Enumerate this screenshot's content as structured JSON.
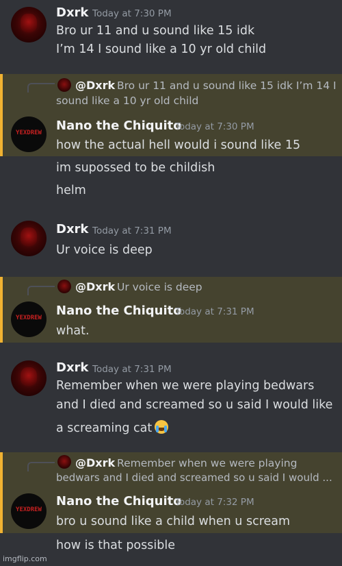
{
  "messages": [
    {
      "author": "Dxrk",
      "time": "Today at 7:30 PM",
      "lines": [
        "Bro ur 11 and u sound like 15 idk",
        "I’m 14 I sound like a 10 yr old child"
      ]
    },
    {
      "reply_to": {
        "author": "@Dxrk",
        "text_line1": "Bro ur 11 and u sound like 15 idk  I’m 14 I",
        "text_line2": "sound like a 10 yr old child"
      },
      "author": "Nano the Chiquito",
      "time": "Today at 7:30 PM",
      "lines": [
        "how the actual hell would i sound like 15",
        "im supossed to be childish",
        "helm"
      ]
    },
    {
      "author": "Dxrk",
      "time": "Today at 7:31 PM",
      "lines": [
        "Ur voice is deep"
      ]
    },
    {
      "reply_to": {
        "author": "@Dxrk",
        "text_line1": "Ur voice is deep"
      },
      "author": "Nano the Chiquito",
      "time": "Today at 7:31 PM",
      "lines": [
        "what."
      ]
    },
    {
      "author": "Dxrk",
      "time": "Today at 7:31 PM",
      "lines": [
        "Remember when we were playing bedwars",
        "and I died and screamed so u said I would like",
        "a screaming cat"
      ],
      "emoji": "loudly-crying-face"
    },
    {
      "reply_to": {
        "author": "@Dxrk",
        "text_line1": "Remember when we were playing",
        "text_line2": "bedwars and I died and screamed so u said I would ..."
      },
      "author": "Nano the Chiquito",
      "time": "Today at 7:32 PM",
      "lines": [
        "bro u sound like a child when u scream",
        "how is that possible"
      ]
    }
  ],
  "avatar_text": "YEXDREW",
  "watermark": "imgflip.com",
  "colors": {
    "background": "#313338",
    "highlight": "#45432f",
    "highlight_bar": "#f0b232"
  }
}
